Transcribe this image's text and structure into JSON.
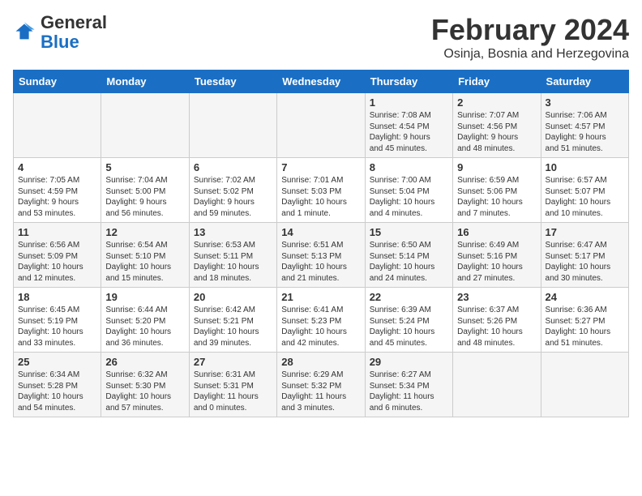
{
  "header": {
    "logo_general": "General",
    "logo_blue": "Blue",
    "month_year": "February 2024",
    "location": "Osinja, Bosnia and Herzegovina"
  },
  "weekdays": [
    "Sunday",
    "Monday",
    "Tuesday",
    "Wednesday",
    "Thursday",
    "Friday",
    "Saturday"
  ],
  "weeks": [
    [
      {
        "day": "",
        "info": ""
      },
      {
        "day": "",
        "info": ""
      },
      {
        "day": "",
        "info": ""
      },
      {
        "day": "",
        "info": ""
      },
      {
        "day": "1",
        "info": "Sunrise: 7:08 AM\nSunset: 4:54 PM\nDaylight: 9 hours\nand 45 minutes."
      },
      {
        "day": "2",
        "info": "Sunrise: 7:07 AM\nSunset: 4:56 PM\nDaylight: 9 hours\nand 48 minutes."
      },
      {
        "day": "3",
        "info": "Sunrise: 7:06 AM\nSunset: 4:57 PM\nDaylight: 9 hours\nand 51 minutes."
      }
    ],
    [
      {
        "day": "4",
        "info": "Sunrise: 7:05 AM\nSunset: 4:59 PM\nDaylight: 9 hours\nand 53 minutes."
      },
      {
        "day": "5",
        "info": "Sunrise: 7:04 AM\nSunset: 5:00 PM\nDaylight: 9 hours\nand 56 minutes."
      },
      {
        "day": "6",
        "info": "Sunrise: 7:02 AM\nSunset: 5:02 PM\nDaylight: 9 hours\nand 59 minutes."
      },
      {
        "day": "7",
        "info": "Sunrise: 7:01 AM\nSunset: 5:03 PM\nDaylight: 10 hours\nand 1 minute."
      },
      {
        "day": "8",
        "info": "Sunrise: 7:00 AM\nSunset: 5:04 PM\nDaylight: 10 hours\nand 4 minutes."
      },
      {
        "day": "9",
        "info": "Sunrise: 6:59 AM\nSunset: 5:06 PM\nDaylight: 10 hours\nand 7 minutes."
      },
      {
        "day": "10",
        "info": "Sunrise: 6:57 AM\nSunset: 5:07 PM\nDaylight: 10 hours\nand 10 minutes."
      }
    ],
    [
      {
        "day": "11",
        "info": "Sunrise: 6:56 AM\nSunset: 5:09 PM\nDaylight: 10 hours\nand 12 minutes."
      },
      {
        "day": "12",
        "info": "Sunrise: 6:54 AM\nSunset: 5:10 PM\nDaylight: 10 hours\nand 15 minutes."
      },
      {
        "day": "13",
        "info": "Sunrise: 6:53 AM\nSunset: 5:11 PM\nDaylight: 10 hours\nand 18 minutes."
      },
      {
        "day": "14",
        "info": "Sunrise: 6:51 AM\nSunset: 5:13 PM\nDaylight: 10 hours\nand 21 minutes."
      },
      {
        "day": "15",
        "info": "Sunrise: 6:50 AM\nSunset: 5:14 PM\nDaylight: 10 hours\nand 24 minutes."
      },
      {
        "day": "16",
        "info": "Sunrise: 6:49 AM\nSunset: 5:16 PM\nDaylight: 10 hours\nand 27 minutes."
      },
      {
        "day": "17",
        "info": "Sunrise: 6:47 AM\nSunset: 5:17 PM\nDaylight: 10 hours\nand 30 minutes."
      }
    ],
    [
      {
        "day": "18",
        "info": "Sunrise: 6:45 AM\nSunset: 5:19 PM\nDaylight: 10 hours\nand 33 minutes."
      },
      {
        "day": "19",
        "info": "Sunrise: 6:44 AM\nSunset: 5:20 PM\nDaylight: 10 hours\nand 36 minutes."
      },
      {
        "day": "20",
        "info": "Sunrise: 6:42 AM\nSunset: 5:21 PM\nDaylight: 10 hours\nand 39 minutes."
      },
      {
        "day": "21",
        "info": "Sunrise: 6:41 AM\nSunset: 5:23 PM\nDaylight: 10 hours\nand 42 minutes."
      },
      {
        "day": "22",
        "info": "Sunrise: 6:39 AM\nSunset: 5:24 PM\nDaylight: 10 hours\nand 45 minutes."
      },
      {
        "day": "23",
        "info": "Sunrise: 6:37 AM\nSunset: 5:26 PM\nDaylight: 10 hours\nand 48 minutes."
      },
      {
        "day": "24",
        "info": "Sunrise: 6:36 AM\nSunset: 5:27 PM\nDaylight: 10 hours\nand 51 minutes."
      }
    ],
    [
      {
        "day": "25",
        "info": "Sunrise: 6:34 AM\nSunset: 5:28 PM\nDaylight: 10 hours\nand 54 minutes."
      },
      {
        "day": "26",
        "info": "Sunrise: 6:32 AM\nSunset: 5:30 PM\nDaylight: 10 hours\nand 57 minutes."
      },
      {
        "day": "27",
        "info": "Sunrise: 6:31 AM\nSunset: 5:31 PM\nDaylight: 11 hours\nand 0 minutes."
      },
      {
        "day": "28",
        "info": "Sunrise: 6:29 AM\nSunset: 5:32 PM\nDaylight: 11 hours\nand 3 minutes."
      },
      {
        "day": "29",
        "info": "Sunrise: 6:27 AM\nSunset: 5:34 PM\nDaylight: 11 hours\nand 6 minutes."
      },
      {
        "day": "",
        "info": ""
      },
      {
        "day": "",
        "info": ""
      }
    ]
  ]
}
